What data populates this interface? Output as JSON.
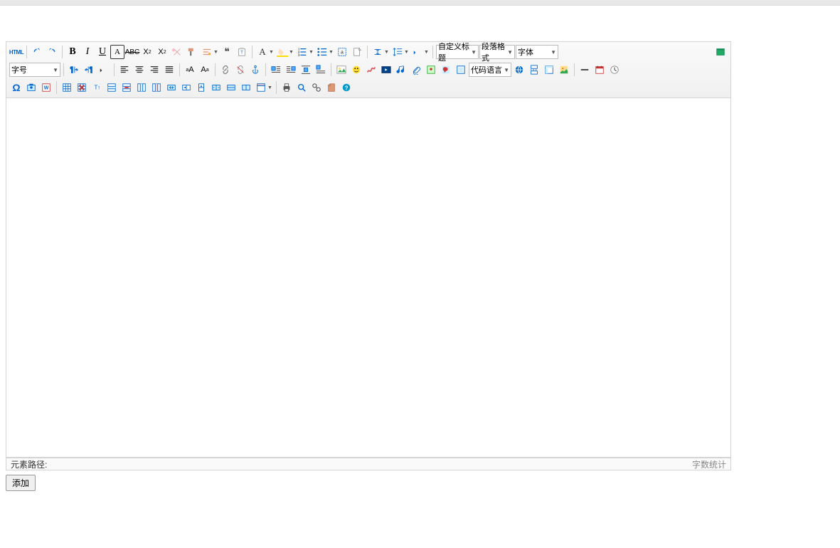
{
  "toolbar": {
    "html": "HTML",
    "custom_title": "自定义标题",
    "paragraph_format": "段落格式",
    "font_family": "字体",
    "font_size": "字号",
    "code_language": "代码语言"
  },
  "statusbar": {
    "element_path": "元素路径:",
    "word_count": "字数统计"
  },
  "buttons": {
    "add": "添加"
  }
}
